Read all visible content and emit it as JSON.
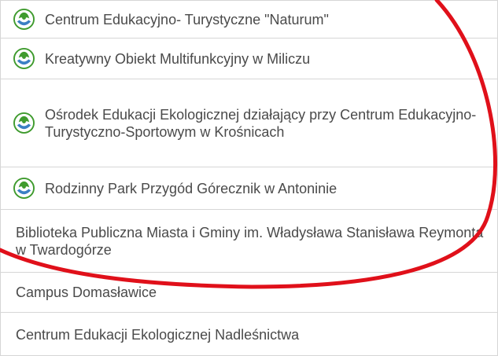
{
  "list": {
    "items": [
      {
        "label": "Centrum Edukacyjno- Turystyczne \"Naturum\"",
        "icon": "eco-leaf-icon"
      },
      {
        "label": "Kreatywny Obiekt Multifunkcyjny w Miliczu",
        "icon": "eco-leaf-icon"
      },
      {
        "label": "Ośrodek Edukacji Ekologicznej działający przy Centrum Edukacyjno-Turystyczno-Sportowym w Krośnicach",
        "icon": "eco-leaf-icon"
      },
      {
        "label": "Rodzinny Park Przygód Górecznik w Antoninie",
        "icon": "eco-leaf-icon"
      },
      {
        "label": "Biblioteka Publiczna Miasta i Gminy im. Władysława Stanisława Reymonta w Twardogórze"
      },
      {
        "label": "Campus Domasławice"
      },
      {
        "label": "Centrum Edukacji Ekologicznej Nadleśnictwa"
      }
    ]
  },
  "colors": {
    "annotation": "#e0101a",
    "icon_green": "#3f9b2e",
    "icon_blue": "#3b7fc4"
  }
}
